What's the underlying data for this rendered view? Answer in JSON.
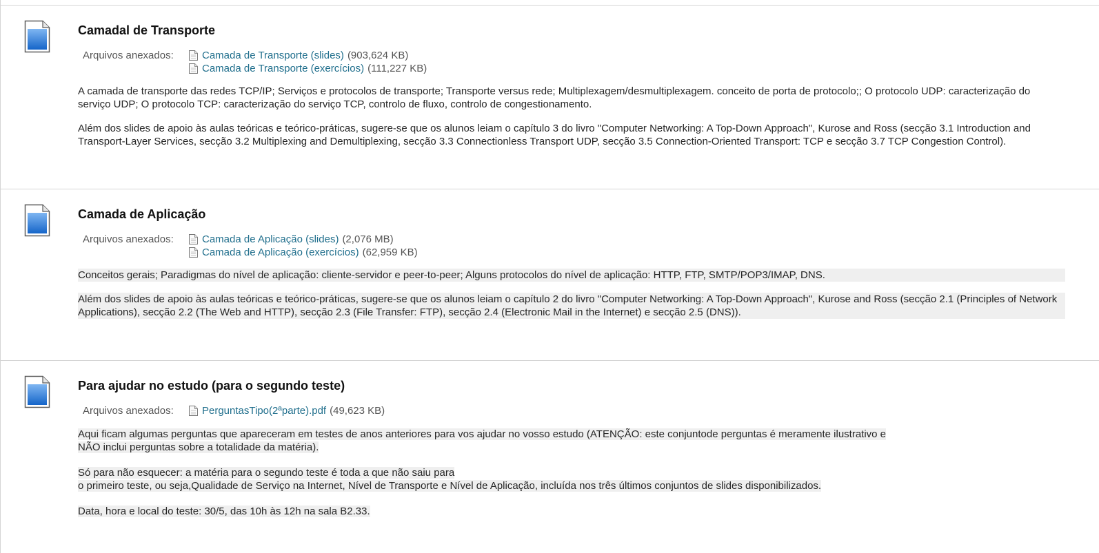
{
  "attachments_label": "Arquivos anexados:",
  "items": [
    {
      "title": "Camadal de Transporte",
      "files": [
        {
          "name": "Camada de Transporte (slides)",
          "size": "(903,624 KB)"
        },
        {
          "name": "Camada de Transporte (exercícios)",
          "size": "(111,227 KB)"
        }
      ],
      "p1": "A camada de transporte das redes TCP/IP; Serviços e protocolos de transporte; Transporte versus rede; Multiplexagem/desmultiplexagem. conceito de porta de protocolo;; O protocolo UDP: caracterização do serviço UDP; O protocolo TCP: caracterização do serviço TCP, controlo de fluxo, controlo de congestionamento.",
      "p2": "Além dos slides de apoio às aulas teóricas e teórico-práticas, sugere-se que os alunos leiam o capítulo 3 do livro \"Computer Networking: A Top-Down Approach\", Kurose and Ross (secção 3.1 Introduction and Transport-Layer Services, secção 3.2 Multiplexing  and Demultiplexing, secção 3.3 Connectionless Transport UDP, secção 3.5 Connection-Oriented Transport: TCP e secção 3.7 TCP Congestion Control)."
    },
    {
      "title": "Camada de Aplicação",
      "files": [
        {
          "name": "Camada de Aplicação (slides)",
          "size": "(2,076 MB)"
        },
        {
          "name": "Camada de Aplicação (exercícios)",
          "size": "(62,959 KB)"
        }
      ],
      "p1": "Conceitos gerais; Paradigmas do nível de aplicação: cliente-servidor e peer-to-peer; Alguns protocolos do nível de aplicação: HTTP, FTP, SMTP/POP3/IMAP, DNS.",
      "p2": "Além dos slides de apoio às aulas teóricas e teórico-práticas, sugere-se que os alunos leiam o capítulo 2 do livro \"Computer Networking: A Top-Down Approach\", Kurose and Ross (secção 2.1 (Principles of Network Applications), secção 2.2 (The Web and HTTP), secção 2.3 (File Transfer: FTP), secção 2.4 (Electronic Mail in the Internet) e secção 2.5 (DNS))."
    },
    {
      "title": "Para ajudar no estudo (para o segundo teste)",
      "files": [
        {
          "name": "PerguntasTipo(2ªparte).pdf",
          "size": "(49,623 KB)"
        }
      ],
      "p1_line1": "Aqui ficam algumas perguntas que apareceram em testes de anos anteriores para vos ajudar no vosso estudo  (ATENÇÃO: este conjuntode perguntas é meramente ilustrativo e",
      "p1_line2": "NÃO inclui perguntas sobre a totalidade da matéria).",
      "p2_line1": "Só para não esquecer: a matéria para o segundo teste é toda a que não saiu para",
      "p2_line2": "o primeiro teste, ou seja,Qualidade de Serviço na Internet, Nível de Transporte e Nível de Aplicação, incluída nos três últimos conjuntos de slides disponibilizados.",
      "p3": "Data, hora e local do teste: 30/5, das 10h às 12h na sala B2.33."
    }
  ]
}
